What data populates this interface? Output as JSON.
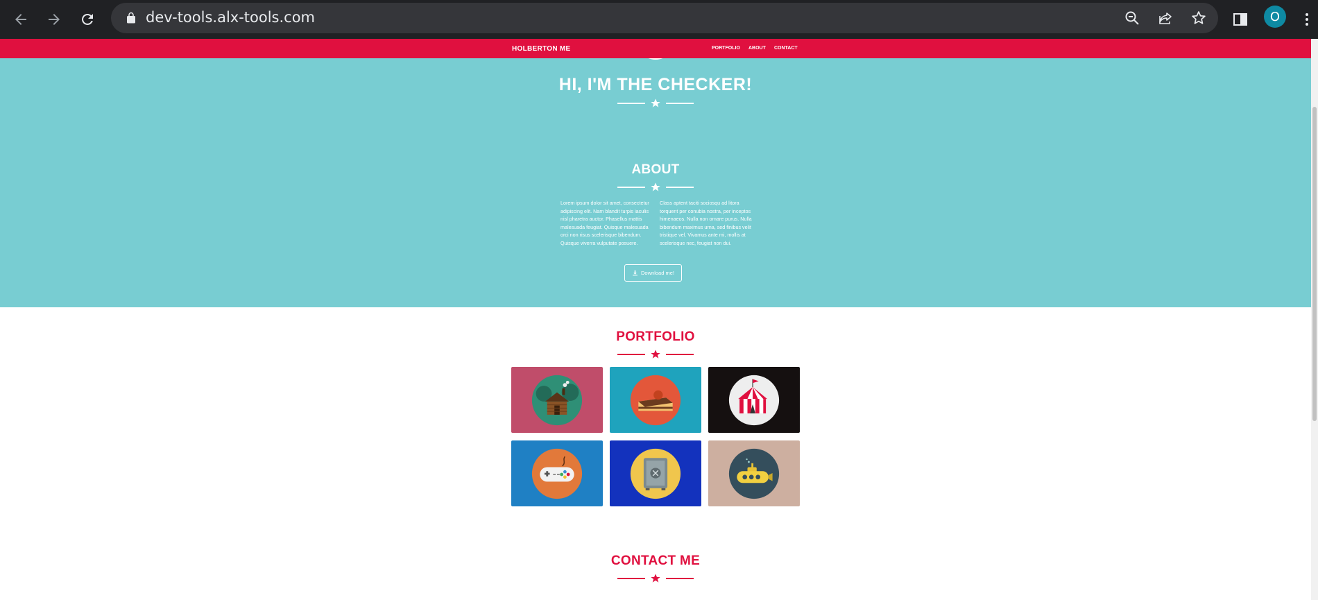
{
  "browser": {
    "url": "dev-tools.alx-tools.com",
    "profile_initial": "O"
  },
  "site": {
    "brand": "HOLBERTON ME",
    "nav_links": [
      "PORTFOLIO",
      "ABOUT",
      "CONTACT"
    ],
    "hero_title": "HI, I'M THE CHECKER!",
    "about": {
      "title": "ABOUT",
      "col_left": "Lorem ipsum dolor sit amet, consectetur adipiscing elit. Nam blandit turpis iaculis nisl pharetra auctor. Phasellus mattis malesuada feugiat. Quisque malesuada orci non risus scelerisque bibendum. Quisque viverra vulputate posuere.",
      "col_right": "Class aptent taciti sociosqu ad litora torquent per conubia nostra, per inceptos himenaeos. Nulla non ornare purus. Nulla bibendum maximus urna, sed finibus velit tristique vel. Vivamus ante mi, mollis at scelerisque nec, feugiat non dui.",
      "button_label": "Download me!"
    },
    "portfolio": {
      "title": "PORTFOLIO",
      "items": [
        {
          "icon": "cabin-icon",
          "bg": "#c04d6a"
        },
        {
          "icon": "cake-icon",
          "bg": "#1fa3bd"
        },
        {
          "icon": "circus-tent-icon",
          "bg": "#151010"
        },
        {
          "icon": "game-controller-icon",
          "bg": "#1f80c4"
        },
        {
          "icon": "safe-icon",
          "bg": "#1332bd"
        },
        {
          "icon": "submarine-icon",
          "bg": "#cdafa0"
        }
      ]
    },
    "contact": {
      "title": "CONTACT ME"
    }
  },
  "colors": {
    "accent": "#e0103f",
    "teal": "#78cdd2",
    "white": "#ffffff"
  }
}
